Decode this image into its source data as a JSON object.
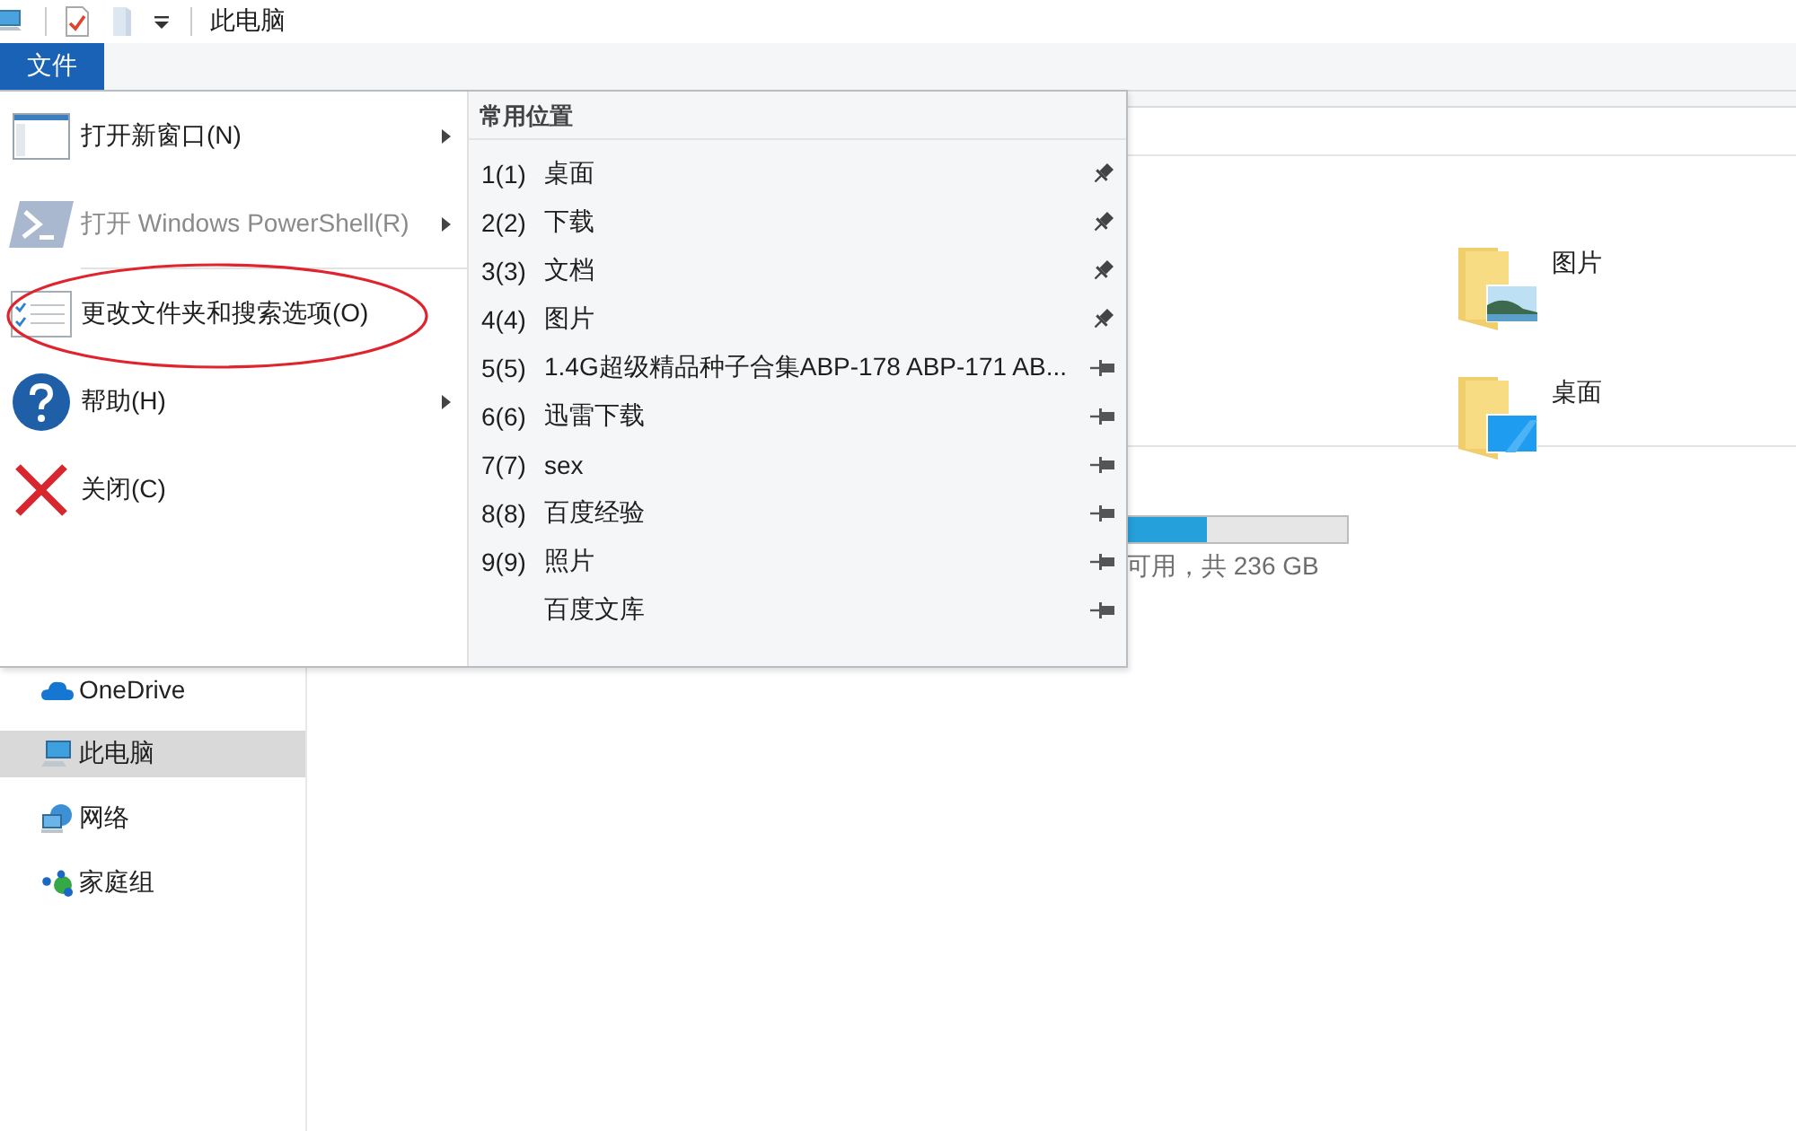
{
  "window": {
    "title": "此电脑"
  },
  "ribbon": {
    "tabs": [
      {
        "label": "文件",
        "selected": true
      }
    ]
  },
  "file_menu": {
    "items": [
      {
        "label": "打开新窗口(N)",
        "submenu": true,
        "disabled": false,
        "divider_above": false,
        "circled": false
      },
      {
        "label": "打开 Windows PowerShell(R)",
        "submenu": true,
        "disabled": true,
        "divider_above": false,
        "circled": false
      },
      {
        "label": "更改文件夹和搜索选项(O)",
        "submenu": false,
        "disabled": false,
        "divider_above": true,
        "circled": true
      },
      {
        "label": "帮助(H)",
        "submenu": true,
        "disabled": false,
        "divider_above": false,
        "circled": false
      },
      {
        "label": "关闭(C)",
        "submenu": false,
        "disabled": false,
        "divider_above": false,
        "circled": false
      }
    ],
    "frequent_places": {
      "title": "常用位置",
      "items": [
        {
          "number": "1(1)",
          "label": "桌面",
          "pinned": true
        },
        {
          "number": "2(2)",
          "label": "下载",
          "pinned": true
        },
        {
          "number": "3(3)",
          "label": "文档",
          "pinned": true
        },
        {
          "number": "4(4)",
          "label": "图片",
          "pinned": true
        },
        {
          "number": "5(5)",
          "label": "1.4G超级精品种子合集ABP-178 ABP-171 AB...",
          "pinned": false
        },
        {
          "number": "6(6)",
          "label": "迅雷下载",
          "pinned": false
        },
        {
          "number": "7(7)",
          "label": "sex",
          "pinned": false
        },
        {
          "number": "8(8)",
          "label": "百度经验",
          "pinned": false
        },
        {
          "number": "9(9)",
          "label": "照片",
          "pinned": false
        },
        {
          "label": "百度文库",
          "pinned": false
        }
      ]
    }
  },
  "sidebar": {
    "items": [
      {
        "label": "OneDrive",
        "selected": false
      },
      {
        "label": "此电脑",
        "selected": true
      },
      {
        "label": "网络",
        "selected": false
      },
      {
        "label": "家庭组",
        "selected": false
      }
    ]
  },
  "content": {
    "folders": [
      {
        "label": "图片"
      },
      {
        "label": "桌面"
      }
    ],
    "drive": {
      "level": 0.36,
      "info": "可用，共 236 GB"
    }
  }
}
